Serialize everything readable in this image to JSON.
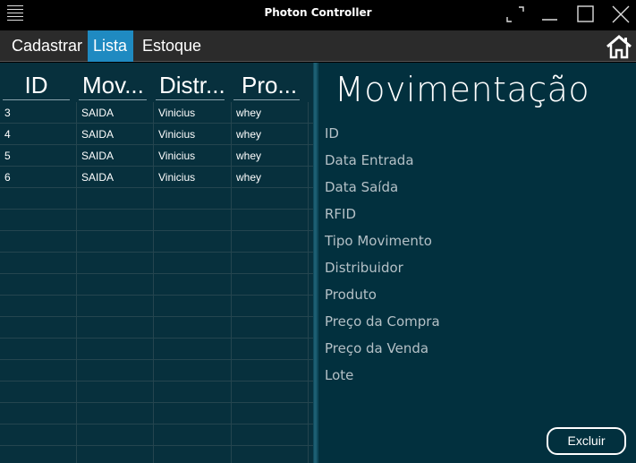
{
  "window": {
    "title": "Photon Controller"
  },
  "menu": {
    "tabs": [
      {
        "label": "Cadastrar"
      },
      {
        "label": "Lista"
      },
      {
        "label": "Estoque"
      }
    ],
    "active_tab": "Lista",
    "accent_color": "#1f8ac1"
  },
  "grid": {
    "columns": [
      "ID",
      "Mov...",
      "Distr...",
      "Pro..."
    ],
    "rows": [
      [
        "3",
        "SAIDA",
        "Vinicius",
        "whey"
      ],
      [
        "4",
        "SAIDA",
        "Vinicius",
        "whey"
      ],
      [
        "5",
        "SAIDA",
        "Vinicius",
        "whey"
      ],
      [
        "6",
        "SAIDA",
        "Vinicius",
        "whey"
      ]
    ]
  },
  "detail": {
    "title": "Movimentação",
    "fields": [
      "ID",
      "Data Entrada",
      "Data Saída",
      "RFID",
      "Tipo Movimento",
      "Distribuidor",
      "Produto",
      "Preço da Compra",
      "Preço da Venda",
      "Lote"
    ],
    "delete_label": "Excluir"
  },
  "icons": {
    "menu": "hamburger-menu-icon",
    "fullscreen": "fullscreen-icon",
    "minimize": "minimize-icon",
    "maximize": "maximize-icon",
    "close": "close-icon",
    "home": "home-icon"
  }
}
